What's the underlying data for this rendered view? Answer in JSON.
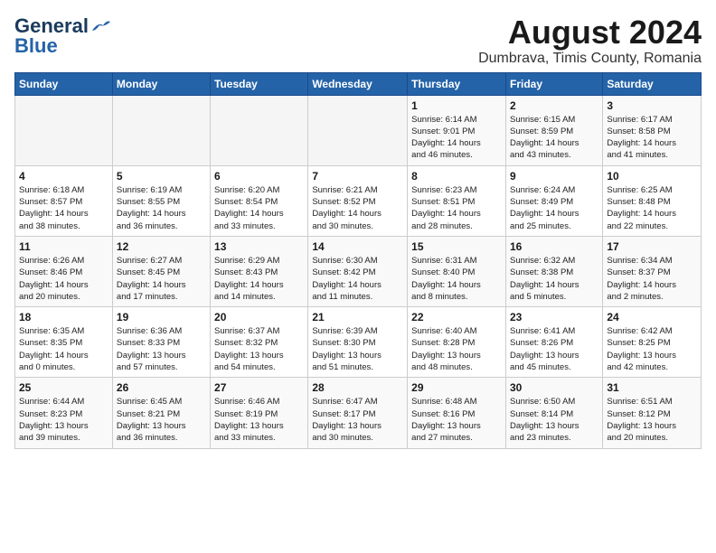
{
  "header": {
    "logo_line1": "General",
    "logo_line2": "Blue",
    "title": "August 2024",
    "subtitle": "Dumbrava, Timis County, Romania"
  },
  "weekdays": [
    "Sunday",
    "Monday",
    "Tuesday",
    "Wednesday",
    "Thursday",
    "Friday",
    "Saturday"
  ],
  "weeks": [
    [
      {
        "day": "",
        "info": ""
      },
      {
        "day": "",
        "info": ""
      },
      {
        "day": "",
        "info": ""
      },
      {
        "day": "",
        "info": ""
      },
      {
        "day": "1",
        "info": "Sunrise: 6:14 AM\nSunset: 9:01 PM\nDaylight: 14 hours\nand 46 minutes."
      },
      {
        "day": "2",
        "info": "Sunrise: 6:15 AM\nSunset: 8:59 PM\nDaylight: 14 hours\nand 43 minutes."
      },
      {
        "day": "3",
        "info": "Sunrise: 6:17 AM\nSunset: 8:58 PM\nDaylight: 14 hours\nand 41 minutes."
      }
    ],
    [
      {
        "day": "4",
        "info": "Sunrise: 6:18 AM\nSunset: 8:57 PM\nDaylight: 14 hours\nand 38 minutes."
      },
      {
        "day": "5",
        "info": "Sunrise: 6:19 AM\nSunset: 8:55 PM\nDaylight: 14 hours\nand 36 minutes."
      },
      {
        "day": "6",
        "info": "Sunrise: 6:20 AM\nSunset: 8:54 PM\nDaylight: 14 hours\nand 33 minutes."
      },
      {
        "day": "7",
        "info": "Sunrise: 6:21 AM\nSunset: 8:52 PM\nDaylight: 14 hours\nand 30 minutes."
      },
      {
        "day": "8",
        "info": "Sunrise: 6:23 AM\nSunset: 8:51 PM\nDaylight: 14 hours\nand 28 minutes."
      },
      {
        "day": "9",
        "info": "Sunrise: 6:24 AM\nSunset: 8:49 PM\nDaylight: 14 hours\nand 25 minutes."
      },
      {
        "day": "10",
        "info": "Sunrise: 6:25 AM\nSunset: 8:48 PM\nDaylight: 14 hours\nand 22 minutes."
      }
    ],
    [
      {
        "day": "11",
        "info": "Sunrise: 6:26 AM\nSunset: 8:46 PM\nDaylight: 14 hours\nand 20 minutes."
      },
      {
        "day": "12",
        "info": "Sunrise: 6:27 AM\nSunset: 8:45 PM\nDaylight: 14 hours\nand 17 minutes."
      },
      {
        "day": "13",
        "info": "Sunrise: 6:29 AM\nSunset: 8:43 PM\nDaylight: 14 hours\nand 14 minutes."
      },
      {
        "day": "14",
        "info": "Sunrise: 6:30 AM\nSunset: 8:42 PM\nDaylight: 14 hours\nand 11 minutes."
      },
      {
        "day": "15",
        "info": "Sunrise: 6:31 AM\nSunset: 8:40 PM\nDaylight: 14 hours\nand 8 minutes."
      },
      {
        "day": "16",
        "info": "Sunrise: 6:32 AM\nSunset: 8:38 PM\nDaylight: 14 hours\nand 5 minutes."
      },
      {
        "day": "17",
        "info": "Sunrise: 6:34 AM\nSunset: 8:37 PM\nDaylight: 14 hours\nand 2 minutes."
      }
    ],
    [
      {
        "day": "18",
        "info": "Sunrise: 6:35 AM\nSunset: 8:35 PM\nDaylight: 14 hours\nand 0 minutes."
      },
      {
        "day": "19",
        "info": "Sunrise: 6:36 AM\nSunset: 8:33 PM\nDaylight: 13 hours\nand 57 minutes."
      },
      {
        "day": "20",
        "info": "Sunrise: 6:37 AM\nSunset: 8:32 PM\nDaylight: 13 hours\nand 54 minutes."
      },
      {
        "day": "21",
        "info": "Sunrise: 6:39 AM\nSunset: 8:30 PM\nDaylight: 13 hours\nand 51 minutes."
      },
      {
        "day": "22",
        "info": "Sunrise: 6:40 AM\nSunset: 8:28 PM\nDaylight: 13 hours\nand 48 minutes."
      },
      {
        "day": "23",
        "info": "Sunrise: 6:41 AM\nSunset: 8:26 PM\nDaylight: 13 hours\nand 45 minutes."
      },
      {
        "day": "24",
        "info": "Sunrise: 6:42 AM\nSunset: 8:25 PM\nDaylight: 13 hours\nand 42 minutes."
      }
    ],
    [
      {
        "day": "25",
        "info": "Sunrise: 6:44 AM\nSunset: 8:23 PM\nDaylight: 13 hours\nand 39 minutes."
      },
      {
        "day": "26",
        "info": "Sunrise: 6:45 AM\nSunset: 8:21 PM\nDaylight: 13 hours\nand 36 minutes."
      },
      {
        "day": "27",
        "info": "Sunrise: 6:46 AM\nSunset: 8:19 PM\nDaylight: 13 hours\nand 33 minutes."
      },
      {
        "day": "28",
        "info": "Sunrise: 6:47 AM\nSunset: 8:17 PM\nDaylight: 13 hours\nand 30 minutes."
      },
      {
        "day": "29",
        "info": "Sunrise: 6:48 AM\nSunset: 8:16 PM\nDaylight: 13 hours\nand 27 minutes."
      },
      {
        "day": "30",
        "info": "Sunrise: 6:50 AM\nSunset: 8:14 PM\nDaylight: 13 hours\nand 23 minutes."
      },
      {
        "day": "31",
        "info": "Sunrise: 6:51 AM\nSunset: 8:12 PM\nDaylight: 13 hours\nand 20 minutes."
      }
    ]
  ]
}
